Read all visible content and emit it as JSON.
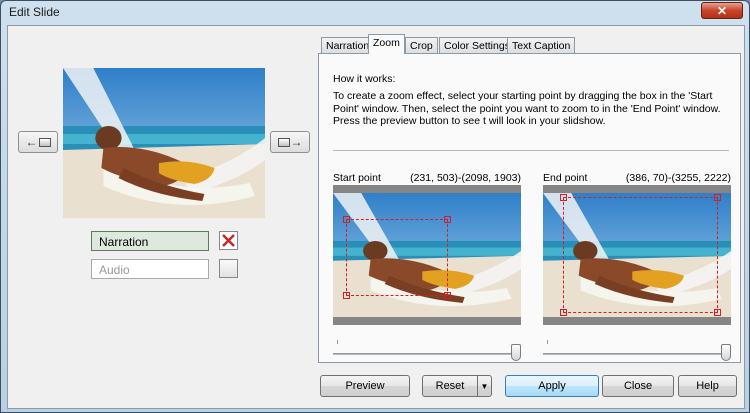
{
  "window": {
    "title": "Edit Slide",
    "close_glyph": "✕"
  },
  "left_panel": {
    "prev_button": {
      "arrow": "←",
      "icon": "slide-thumbnail-icon"
    },
    "next_button": {
      "arrow": "→",
      "icon": "slide-thumbnail-icon"
    },
    "narration_value": "Narration",
    "audio_placeholder": "Audio"
  },
  "tabs": [
    {
      "label": "Narration"
    },
    {
      "label": "Zoom"
    },
    {
      "label": "Crop"
    },
    {
      "label": "Color Settings"
    },
    {
      "label": "Text Caption"
    }
  ],
  "active_tab": "Zoom",
  "zoom": {
    "how_title": "How it works:",
    "how_body": "To create a zoom effect, select your starting point by dragging the box in the 'Start Point' window. Then, select the point you want to zoom to in the 'End Point' window. Press the preview button to see t will look in your slidshow.",
    "start": {
      "label": "Start point",
      "coords": "(231, 503)-(2098, 1903)"
    },
    "end": {
      "label": "End point",
      "coords": "(386, 70)-(3255, 2222)"
    }
  },
  "buttons": {
    "preview": "Preview",
    "reset": "Reset",
    "reset_arrow": "▼",
    "apply": "Apply",
    "close": "Close",
    "help": "Help"
  },
  "colors": {
    "selection_box": "#d0202a",
    "narration_field_bg": "#dde9dc",
    "delete_x": "#c0282a"
  }
}
